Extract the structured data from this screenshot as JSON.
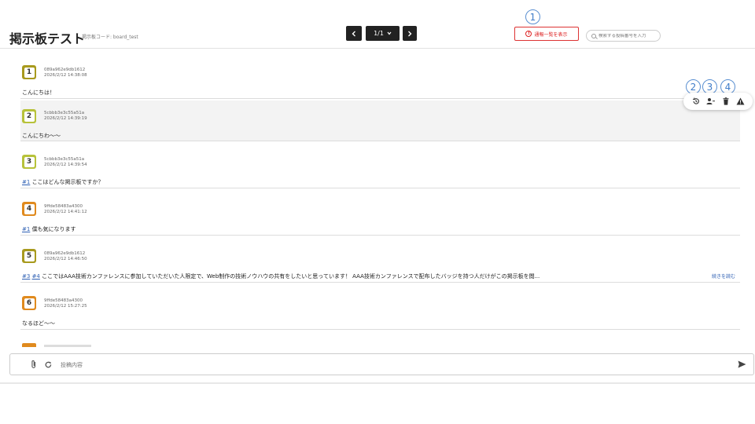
{
  "header": {
    "title": "掲示板テスト",
    "code_label": "掲示板コード: board_test",
    "pagination": {
      "page": "1/1"
    },
    "report_button": "通報一覧を表示",
    "search_placeholder": "検索する投稿番号を入力"
  },
  "markers": [
    "1",
    "2",
    "3",
    "4"
  ],
  "posts": [
    {
      "num": "1",
      "id": "089a962e9db1612",
      "date": "2026/2/12 14:38:08",
      "refs": [],
      "text": "こんにちは！",
      "color": "#a89a1e"
    },
    {
      "num": "2",
      "id": "5cbbb3e3c55a51a",
      "date": "2026/2/12 14:39:19",
      "refs": [],
      "text": "こんにちわ〜〜",
      "color": "#b7c23a"
    },
    {
      "num": "3",
      "id": "5cbbb3e3c55a51a",
      "date": "2026/2/12 14:39:54",
      "refs": [
        "#1"
      ],
      "text": "ここはどんな掲示板ですか？",
      "color": "#b7c23a"
    },
    {
      "num": "4",
      "id": "9ffde58483a4300",
      "date": "2026/2/12 14:41:12",
      "refs": [
        "#1"
      ],
      "text": "僕も気になります",
      "color": "#e08a1e"
    },
    {
      "num": "5",
      "id": "089a962e9db1612",
      "date": "2026/2/12 14:46:50",
      "refs": [
        "#3",
        "#4"
      ],
      "text": "ここではAAA技術カンファレンスに参加していただいた人限定で、Web制作の技術ノウハウの共有をしたいと思っています！ AAA技術カンファレンスで配布したバッジを持つ人だけがこの掲示板を閲...",
      "more": "続きを読む",
      "color": "#a89a1e"
    },
    {
      "num": "6",
      "id": "9ffde58483a4300",
      "date": "2026/2/12 15:27:25",
      "refs": [],
      "text": "なるほど〜〜",
      "color": "#e08a1e"
    }
  ],
  "composer": {
    "placeholder": "投稿内容"
  },
  "icons": {
    "history": "history-icon",
    "block_user": "person-remove-icon",
    "delete": "trash-icon",
    "report": "warning-icon",
    "attach": "paperclip-icon",
    "refresh": "refresh-icon",
    "send": "send-icon"
  },
  "colors": {
    "accent_red": "#dd2222",
    "link_blue": "#2d5fb3",
    "marker_blue": "#3f7cc9"
  }
}
